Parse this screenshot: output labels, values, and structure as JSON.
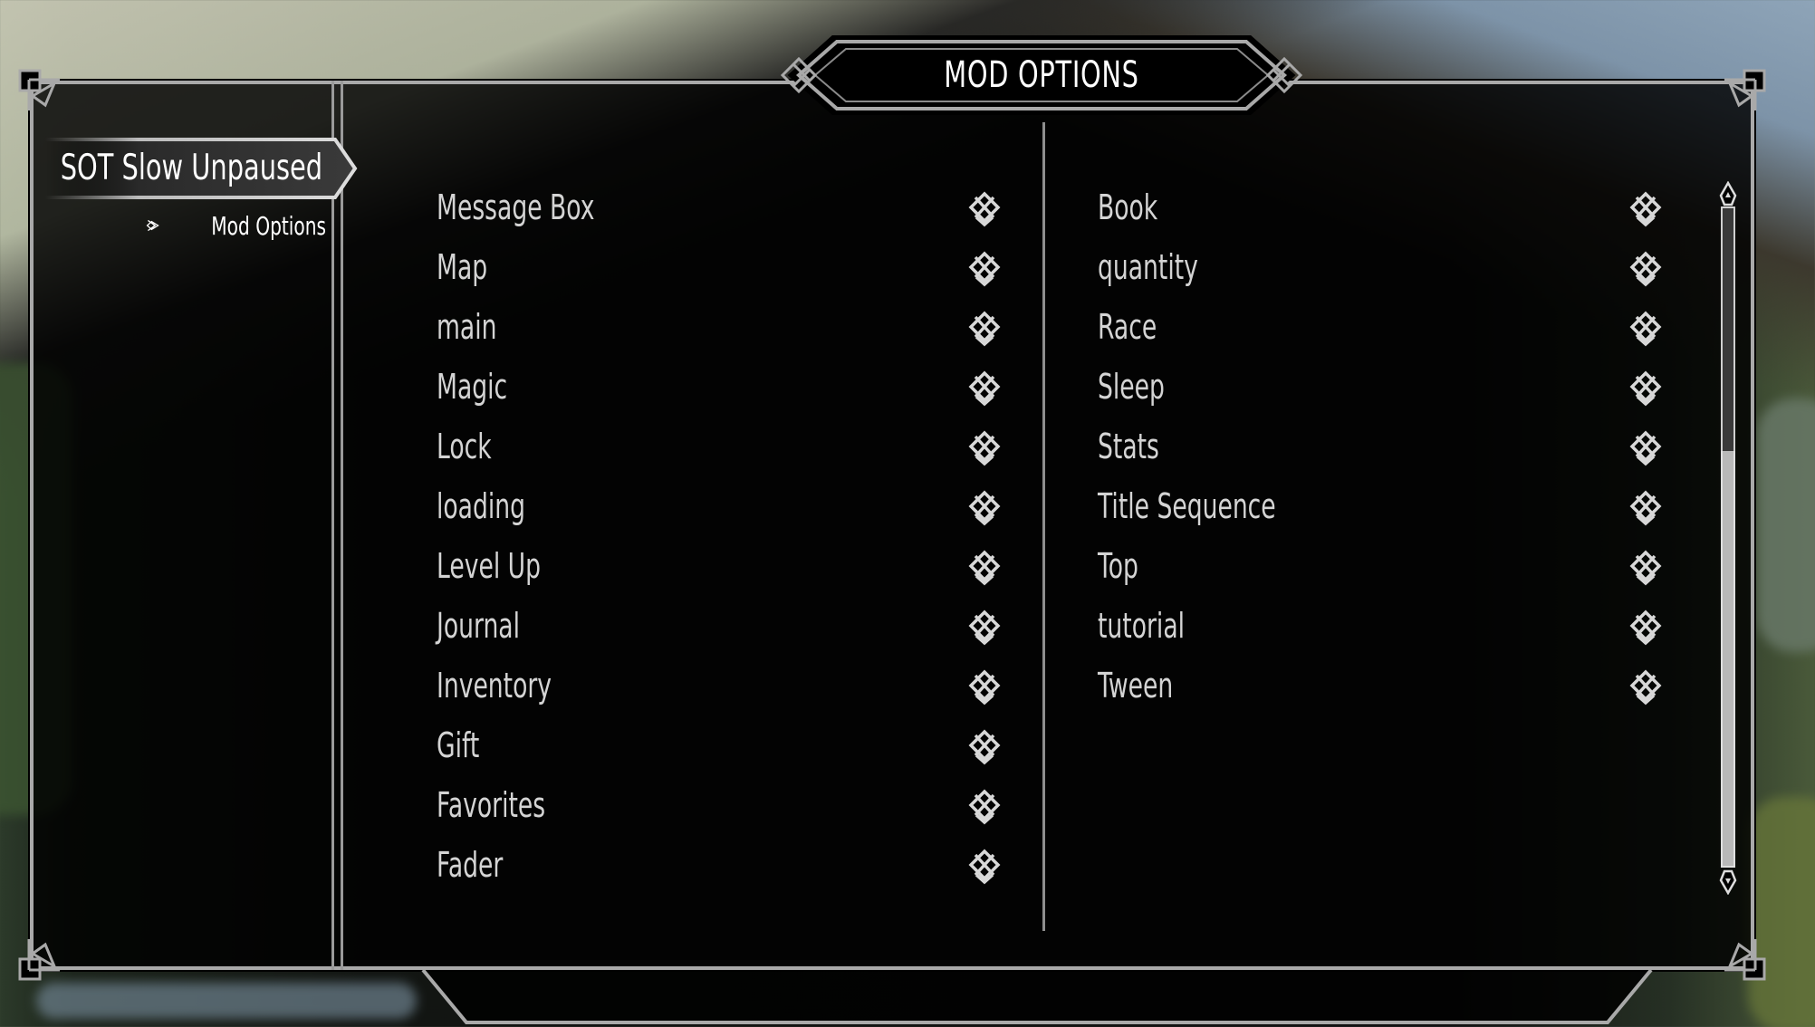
{
  "header": {
    "title": "MOD OPTIONS",
    "ornament_icon": "celtic-knot-icon"
  },
  "sidebar": {
    "selected_mod": "SOT Slow Unpaused",
    "pages": [
      {
        "label": "Mod Options",
        "icon": "knot-arrow-icon"
      }
    ]
  },
  "options": {
    "left_column": [
      {
        "label": "Message Box",
        "icon": "knot-diamond-icon"
      },
      {
        "label": "Map",
        "icon": "knot-diamond-icon"
      },
      {
        "label": "main",
        "icon": "knot-diamond-icon"
      },
      {
        "label": "Magic",
        "icon": "knot-diamond-icon"
      },
      {
        "label": "Lock",
        "icon": "knot-diamond-icon"
      },
      {
        "label": "loading",
        "icon": "knot-diamond-icon"
      },
      {
        "label": "Level Up",
        "icon": "knot-diamond-icon"
      },
      {
        "label": "Journal",
        "icon": "knot-diamond-icon"
      },
      {
        "label": "Inventory",
        "icon": "knot-diamond-icon"
      },
      {
        "label": "Gift",
        "icon": "knot-diamond-icon"
      },
      {
        "label": "Favorites",
        "icon": "knot-diamond-icon"
      },
      {
        "label": "Fader",
        "icon": "knot-diamond-icon"
      }
    ],
    "right_column": [
      {
        "label": "Book",
        "icon": "knot-diamond-icon"
      },
      {
        "label": "quantity",
        "icon": "knot-diamond-icon"
      },
      {
        "label": "Race",
        "icon": "knot-diamond-icon"
      },
      {
        "label": "Sleep",
        "icon": "knot-diamond-icon"
      },
      {
        "label": "Stats",
        "icon": "knot-diamond-icon"
      },
      {
        "label": "Title Sequence",
        "icon": "knot-diamond-icon"
      },
      {
        "label": "Top",
        "icon": "knot-diamond-icon"
      },
      {
        "label": "tutorial",
        "icon": "knot-diamond-icon"
      },
      {
        "label": "Tween",
        "icon": "knot-diamond-icon"
      }
    ]
  },
  "scrollbar": {
    "thumb_fraction": 0.37,
    "position_fraction": 0.0
  },
  "colors": {
    "frame": "#a9a9a9",
    "text_primary": "#ffffff",
    "text_option": "#d4d4d4",
    "panel_bg": "#000000"
  }
}
